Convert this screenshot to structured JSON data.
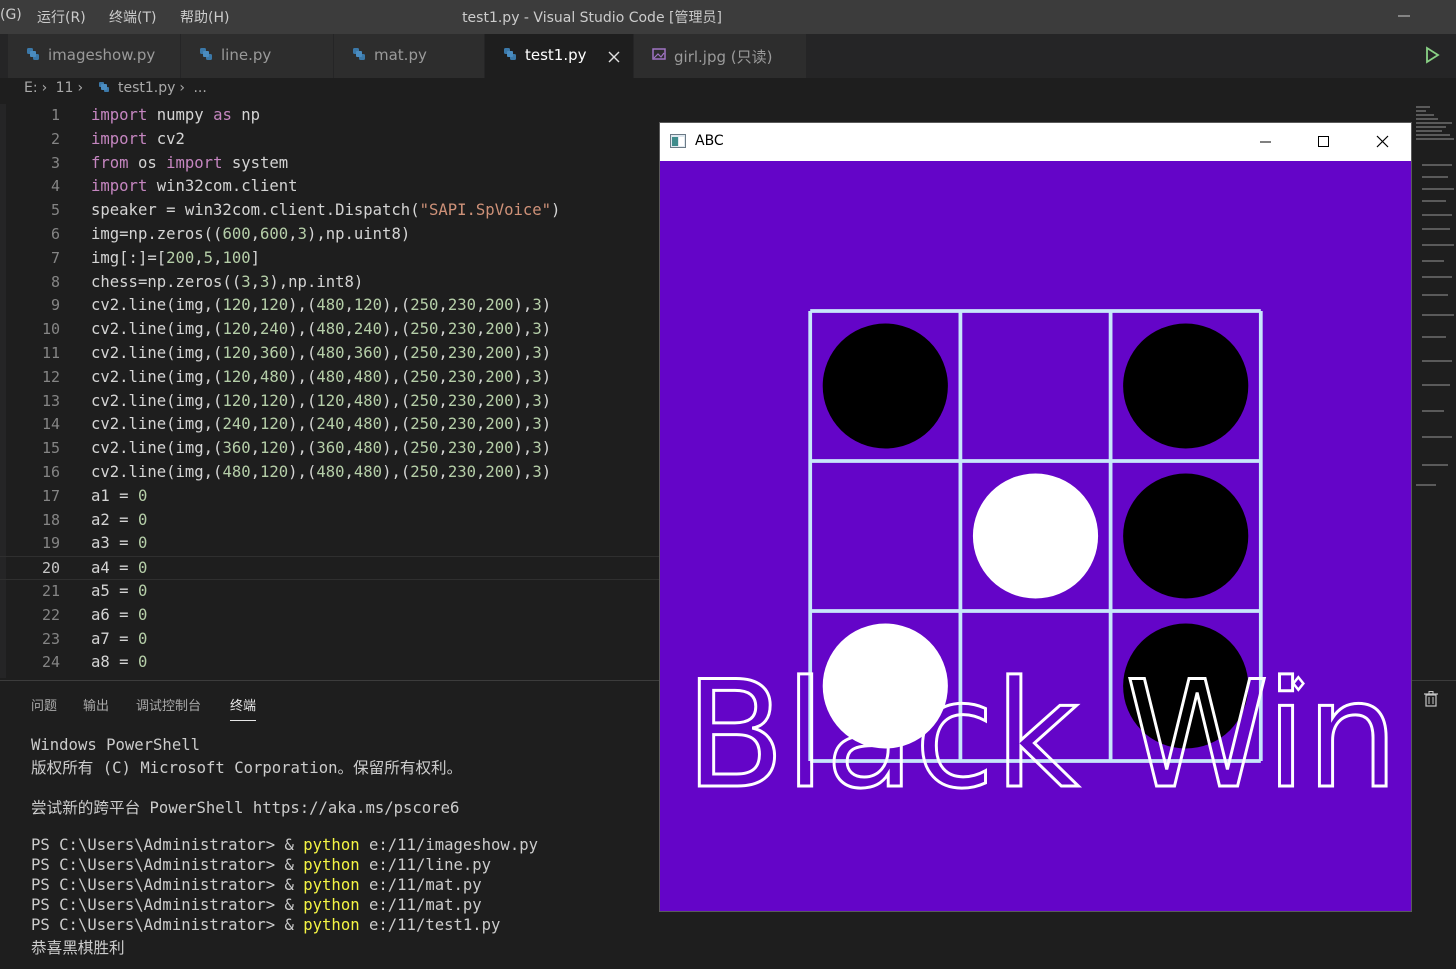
{
  "titlebar": {
    "menus": [
      "(G)",
      "运行(R)",
      "终端(T)",
      "帮助(H)"
    ],
    "title": "test1.py - Visual Studio Code [管理员]"
  },
  "tabs": [
    {
      "label": "imageshow.py",
      "icon": "python-file-icon",
      "active": false
    },
    {
      "label": "line.py",
      "icon": "python-file-icon",
      "active": false
    },
    {
      "label": "mat.py",
      "icon": "python-file-icon",
      "active": false
    },
    {
      "label": "test1.py",
      "icon": "python-file-icon",
      "active": true
    },
    {
      "label": "girl.jpg (只读)",
      "icon": "image-file-icon",
      "active": false
    }
  ],
  "breadcrumb": {
    "drive": "E:",
    "folder": "11",
    "file": "test1.py",
    "more": "..."
  },
  "editor": {
    "current_line": 20,
    "lines": [
      "import numpy as np",
      "import cv2",
      "from os import system",
      "import win32com.client",
      "speaker = win32com.client.Dispatch(\"SAPI.SpVoice\")",
      "img=np.zeros((600,600,3),np.uint8)",
      "img[:]=[200,5,100]",
      "chess=np.zeros((3,3),np.int8)",
      "cv2.line(img,(120,120),(480,120),(250,230,200),3)",
      "cv2.line(img,(120,240),(480,240),(250,230,200),3)",
      "cv2.line(img,(120,360),(480,360),(250,230,200),3)",
      "cv2.line(img,(120,480),(480,480),(250,230,200),3)",
      "cv2.line(img,(120,120),(120,480),(250,230,200),3)",
      "cv2.line(img,(240,120),(240,480),(250,230,200),3)",
      "cv2.line(img,(360,120),(360,480),(250,230,200),3)",
      "cv2.line(img,(480,120),(480,480),(250,230,200),3)",
      "a1 = 0",
      "a2 = 0",
      "a3 = 0",
      "a4 = 0",
      "a5 = 0",
      "a6 = 0",
      "a7 = 0",
      "a8 = 0"
    ]
  },
  "panel": {
    "tabs": [
      "问题",
      "输出",
      "调试控制台",
      "终端"
    ],
    "active_tab": "终端",
    "terminal": [
      {
        "text": "Windows PowerShell"
      },
      {
        "text": "版权所有 (C) Microsoft Corporation。保留所有权利。"
      },
      {
        "text": ""
      },
      {
        "text": "尝试新的跨平台 PowerShell https://aka.ms/pscore6"
      },
      {
        "text": ""
      },
      {
        "prompt": "PS C:\\Users\\Administrator> & ",
        "cmd": "python",
        "arg": " e:/11/imageshow.py"
      },
      {
        "prompt": "PS C:\\Users\\Administrator> & ",
        "cmd": "python",
        "arg": " e:/11/line.py"
      },
      {
        "prompt": "PS C:\\Users\\Administrator> & ",
        "cmd": "python",
        "arg": " e:/11/mat.py"
      },
      {
        "prompt": "PS C:\\Users\\Administrator> & ",
        "cmd": "python",
        "arg": " e:/11/mat.py"
      },
      {
        "prompt": "PS C:\\Users\\Administrator> & ",
        "cmd": "python",
        "arg": " e:/11/test1.py"
      },
      {
        "text": "恭喜黑棋胜利"
      }
    ]
  },
  "cv_window": {
    "title": "ABC",
    "background_color": "#6405c8",
    "grid_color": "#c8e6fa",
    "board": [
      [
        "black",
        "",
        "black"
      ],
      [
        "",
        "white",
        "black"
      ],
      [
        "white",
        "",
        "black"
      ]
    ],
    "overlay_text": "Black  Win"
  },
  "colors": {
    "keyword": "#c586c0",
    "string": "#ce9178",
    "number": "#b5cea8",
    "terminal_command": "#f5f543"
  }
}
